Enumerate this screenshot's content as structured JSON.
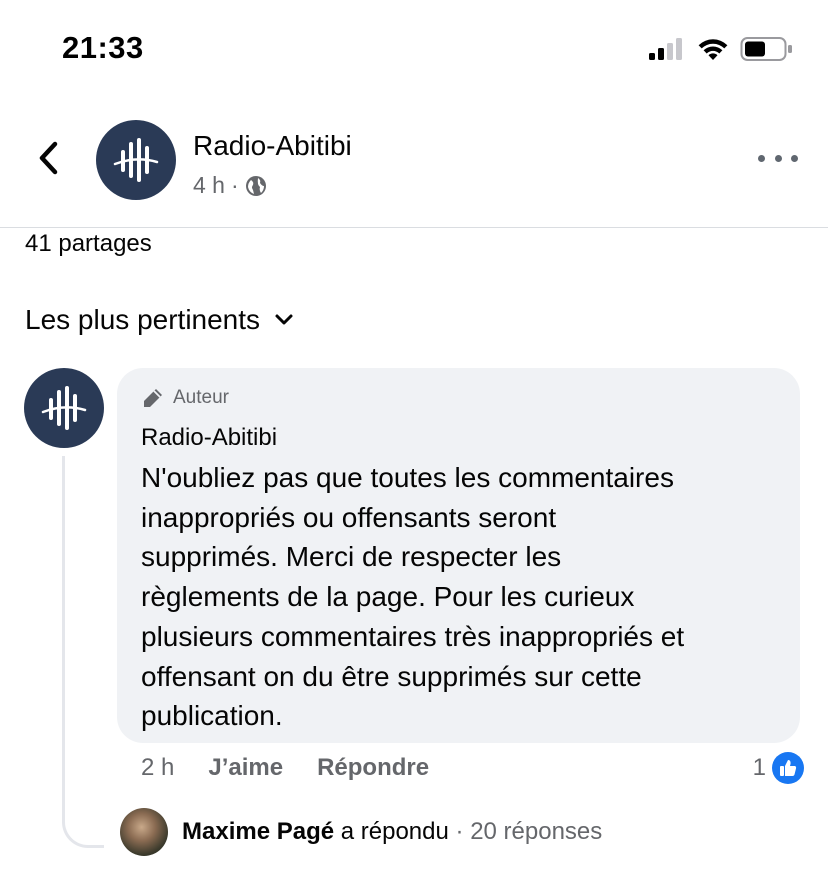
{
  "status_bar": {
    "time": "21:33"
  },
  "header": {
    "page_name": "Radio-Abitibi",
    "post_age": "4 h",
    "separator": "·",
    "back_icon": "chevron-left-icon",
    "privacy_icon": "globe-icon",
    "more_icon": "more-horizontal-icon"
  },
  "post": {
    "shares": "41 partages"
  },
  "comments": {
    "sort_label": "Les plus pertinents",
    "first_comment": {
      "badge": "Auteur",
      "author": "Radio-Abitibi",
      "text_lines": [
        "N'oubliez pas que toutes les commentaires",
        "inappropriés ou offensants seront",
        "supprimés. Merci de respecter les",
        "règlements de la page. Pour les curieux",
        "plusieurs commentaires très inappropriés et",
        "offensant on du être supprimés sur cette",
        "publication."
      ],
      "age": "2 h",
      "like_label": "J’aime",
      "reply_label": "Répondre",
      "reaction_count": "1"
    },
    "reply_summary": {
      "name": "Maxime Pagé",
      "action": "a répondu",
      "separator": "·",
      "count": "20 réponses"
    }
  },
  "colors": {
    "brand_navy": "#2a3a56",
    "facebook_blue": "#1877f2",
    "bubble_bg": "#f0f2f5",
    "secondary_text": "#65676b"
  }
}
